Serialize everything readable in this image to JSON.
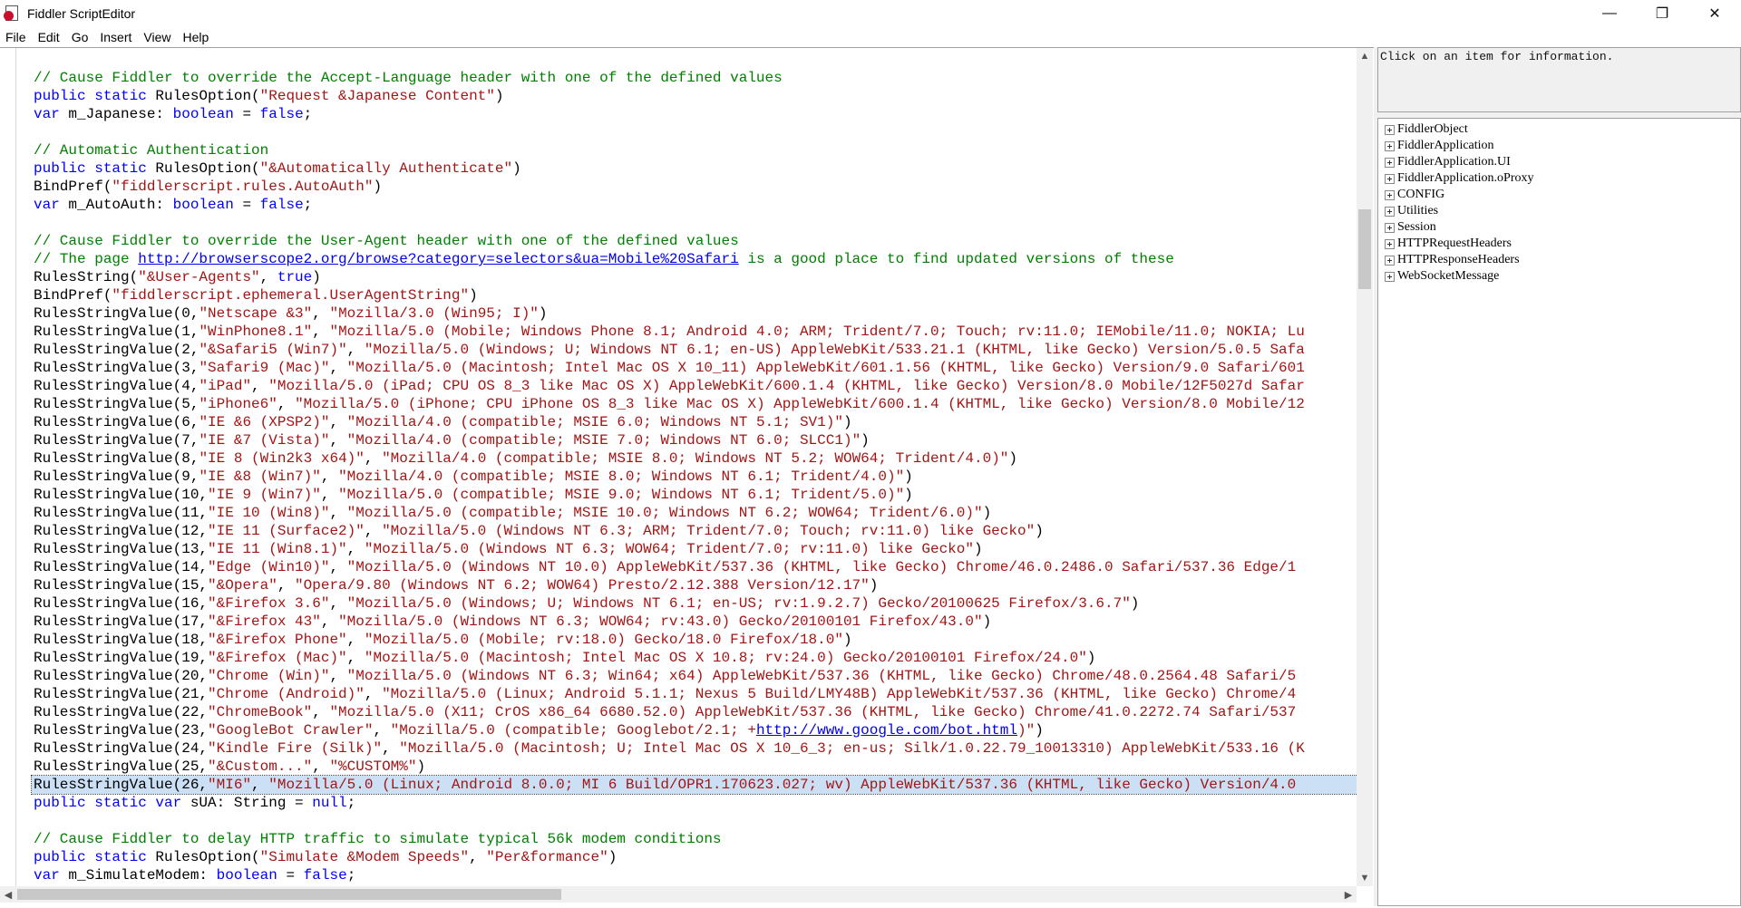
{
  "window": {
    "title": "Fiddler ScriptEditor",
    "minimize": "—",
    "restore": "❐",
    "close": "✕"
  },
  "menu": [
    "File",
    "Edit",
    "Go",
    "Insert",
    "View",
    "Help"
  ],
  "code": [
    [
      [
        "c",
        "// Cause Fiddler to override the Accept-Language header with one of the defined values"
      ]
    ],
    [
      [
        "k",
        "public static "
      ],
      [
        "d",
        "RulesOption("
      ],
      [
        "s",
        "\"Request &Japanese Content\""
      ],
      [
        "d",
        ")"
      ]
    ],
    [
      [
        "k",
        "var "
      ],
      [
        "d",
        "m_Japanese: "
      ],
      [
        "k",
        "boolean"
      ],
      [
        "d",
        " = "
      ],
      [
        "k",
        "false"
      ],
      [
        "d",
        ";"
      ]
    ],
    [],
    [
      [
        "c",
        "// Automatic Authentication"
      ]
    ],
    [
      [
        "k",
        "public static "
      ],
      [
        "d",
        "RulesOption("
      ],
      [
        "s",
        "\"&Automatically Authenticate\""
      ],
      [
        "d",
        ")"
      ]
    ],
    [
      [
        "d",
        "BindPref("
      ],
      [
        "s",
        "\"fiddlerscript.rules.AutoAuth\""
      ],
      [
        "d",
        ")"
      ]
    ],
    [
      [
        "k",
        "var "
      ],
      [
        "d",
        "m_AutoAuth: "
      ],
      [
        "k",
        "boolean"
      ],
      [
        "d",
        " = "
      ],
      [
        "k",
        "false"
      ],
      [
        "d",
        ";"
      ]
    ],
    [],
    [
      [
        "c",
        "// Cause Fiddler to override the User-Agent header with one of the defined values"
      ]
    ],
    [
      [
        "c",
        "// The page "
      ],
      [
        "l",
        "http://browserscope2.org/browse?category=selectors&ua=Mobile%20Safari"
      ],
      [
        "c",
        " is a good place to find updated versions of these"
      ]
    ],
    [
      [
        "d",
        "RulesString("
      ],
      [
        "s",
        "\"&User-Agents\""
      ],
      [
        "d",
        ", "
      ],
      [
        "k",
        "true"
      ],
      [
        "d",
        ")"
      ]
    ],
    [
      [
        "d",
        "BindPref("
      ],
      [
        "s",
        "\"fiddlerscript.ephemeral.UserAgentString\""
      ],
      [
        "d",
        ")"
      ]
    ],
    [
      [
        "d",
        "RulesStringValue(0,"
      ],
      [
        "s",
        "\"Netscape &3\""
      ],
      [
        "d",
        ", "
      ],
      [
        "s",
        "\"Mozilla/3.0 (Win95; I)\""
      ],
      [
        "d",
        ")"
      ]
    ],
    [
      [
        "d",
        "RulesStringValue(1,"
      ],
      [
        "s",
        "\"WinPhone8.1\""
      ],
      [
        "d",
        ", "
      ],
      [
        "s",
        "\"Mozilla/5.0 (Mobile; Windows Phone 8.1; Android 4.0; ARM; Trident/7.0; Touch; rv:11.0; IEMobile/11.0; NOKIA; Lu"
      ]
    ],
    [
      [
        "d",
        "RulesStringValue(2,"
      ],
      [
        "s",
        "\"&Safari5 (Win7)\""
      ],
      [
        "d",
        ", "
      ],
      [
        "s",
        "\"Mozilla/5.0 (Windows; U; Windows NT 6.1; en-US) AppleWebKit/533.21.1 (KHTML, like Gecko) Version/5.0.5 Safa"
      ]
    ],
    [
      [
        "d",
        "RulesStringValue(3,"
      ],
      [
        "s",
        "\"Safari9 (Mac)\""
      ],
      [
        "d",
        ", "
      ],
      [
        "s",
        "\"Mozilla/5.0 (Macintosh; Intel Mac OS X 10_11) AppleWebKit/601.1.56 (KHTML, like Gecko) Version/9.0 Safari/601"
      ]
    ],
    [
      [
        "d",
        "RulesStringValue(4,"
      ],
      [
        "s",
        "\"iPad\""
      ],
      [
        "d",
        ", "
      ],
      [
        "s",
        "\"Mozilla/5.0 (iPad; CPU OS 8_3 like Mac OS X) AppleWebKit/600.1.4 (KHTML, like Gecko) Version/8.0 Mobile/12F5027d Safar"
      ]
    ],
    [
      [
        "d",
        "RulesStringValue(5,"
      ],
      [
        "s",
        "\"iPhone6\""
      ],
      [
        "d",
        ", "
      ],
      [
        "s",
        "\"Mozilla/5.0 (iPhone; CPU iPhone OS 8_3 like Mac OS X) AppleWebKit/600.1.4 (KHTML, like Gecko) Version/8.0 Mobile/12"
      ]
    ],
    [
      [
        "d",
        "RulesStringValue(6,"
      ],
      [
        "s",
        "\"IE &6 (XPSP2)\""
      ],
      [
        "d",
        ", "
      ],
      [
        "s",
        "\"Mozilla/4.0 (compatible; MSIE 6.0; Windows NT 5.1; SV1)\""
      ],
      [
        "d",
        ")"
      ]
    ],
    [
      [
        "d",
        "RulesStringValue(7,"
      ],
      [
        "s",
        "\"IE &7 (Vista)\""
      ],
      [
        "d",
        ", "
      ],
      [
        "s",
        "\"Mozilla/4.0 (compatible; MSIE 7.0; Windows NT 6.0; SLCC1)\""
      ],
      [
        "d",
        ")"
      ]
    ],
    [
      [
        "d",
        "RulesStringValue(8,"
      ],
      [
        "s",
        "\"IE 8 (Win2k3 x64)\""
      ],
      [
        "d",
        ", "
      ],
      [
        "s",
        "\"Mozilla/4.0 (compatible; MSIE 8.0; Windows NT 5.2; WOW64; Trident/4.0)\""
      ],
      [
        "d",
        ")"
      ]
    ],
    [
      [
        "d",
        "RulesStringValue(9,"
      ],
      [
        "s",
        "\"IE &8 (Win7)\""
      ],
      [
        "d",
        ", "
      ],
      [
        "s",
        "\"Mozilla/4.0 (compatible; MSIE 8.0; Windows NT 6.1; Trident/4.0)\""
      ],
      [
        "d",
        ")"
      ]
    ],
    [
      [
        "d",
        "RulesStringValue(10,"
      ],
      [
        "s",
        "\"IE 9 (Win7)\""
      ],
      [
        "d",
        ", "
      ],
      [
        "s",
        "\"Mozilla/5.0 (compatible; MSIE 9.0; Windows NT 6.1; Trident/5.0)\""
      ],
      [
        "d",
        ")"
      ]
    ],
    [
      [
        "d",
        "RulesStringValue(11,"
      ],
      [
        "s",
        "\"IE 10 (Win8)\""
      ],
      [
        "d",
        ", "
      ],
      [
        "s",
        "\"Mozilla/5.0 (compatible; MSIE 10.0; Windows NT 6.2; WOW64; Trident/6.0)\""
      ],
      [
        "d",
        ")"
      ]
    ],
    [
      [
        "d",
        "RulesStringValue(12,"
      ],
      [
        "s",
        "\"IE 11 (Surface2)\""
      ],
      [
        "d",
        ", "
      ],
      [
        "s",
        "\"Mozilla/5.0 (Windows NT 6.3; ARM; Trident/7.0; Touch; rv:11.0) like Gecko\""
      ],
      [
        "d",
        ")"
      ]
    ],
    [
      [
        "d",
        "RulesStringValue(13,"
      ],
      [
        "s",
        "\"IE 11 (Win8.1)\""
      ],
      [
        "d",
        ", "
      ],
      [
        "s",
        "\"Mozilla/5.0 (Windows NT 6.3; WOW64; Trident/7.0; rv:11.0) like Gecko\""
      ],
      [
        "d",
        ")"
      ]
    ],
    [
      [
        "d",
        "RulesStringValue(14,"
      ],
      [
        "s",
        "\"Edge (Win10)\""
      ],
      [
        "d",
        ", "
      ],
      [
        "s",
        "\"Mozilla/5.0 (Windows NT 10.0) AppleWebKit/537.36 (KHTML, like Gecko) Chrome/46.0.2486.0 Safari/537.36 Edge/1"
      ]
    ],
    [
      [
        "d",
        "RulesStringValue(15,"
      ],
      [
        "s",
        "\"&Opera\""
      ],
      [
        "d",
        ", "
      ],
      [
        "s",
        "\"Opera/9.80 (Windows NT 6.2; WOW64) Presto/2.12.388 Version/12.17\""
      ],
      [
        "d",
        ")"
      ]
    ],
    [
      [
        "d",
        "RulesStringValue(16,"
      ],
      [
        "s",
        "\"&Firefox 3.6\""
      ],
      [
        "d",
        ", "
      ],
      [
        "s",
        "\"Mozilla/5.0 (Windows; U; Windows NT 6.1; en-US; rv:1.9.2.7) Gecko/20100625 Firefox/3.6.7\""
      ],
      [
        "d",
        ")"
      ]
    ],
    [
      [
        "d",
        "RulesStringValue(17,"
      ],
      [
        "s",
        "\"&Firefox 43\""
      ],
      [
        "d",
        ", "
      ],
      [
        "s",
        "\"Mozilla/5.0 (Windows NT 6.3; WOW64; rv:43.0) Gecko/20100101 Firefox/43.0\""
      ],
      [
        "d",
        ")"
      ]
    ],
    [
      [
        "d",
        "RulesStringValue(18,"
      ],
      [
        "s",
        "\"&Firefox Phone\""
      ],
      [
        "d",
        ", "
      ],
      [
        "s",
        "\"Mozilla/5.0 (Mobile; rv:18.0) Gecko/18.0 Firefox/18.0\""
      ],
      [
        "d",
        ")"
      ]
    ],
    [
      [
        "d",
        "RulesStringValue(19,"
      ],
      [
        "s",
        "\"&Firefox (Mac)\""
      ],
      [
        "d",
        ", "
      ],
      [
        "s",
        "\"Mozilla/5.0 (Macintosh; Intel Mac OS X 10.8; rv:24.0) Gecko/20100101 Firefox/24.0\""
      ],
      [
        "d",
        ")"
      ]
    ],
    [
      [
        "d",
        "RulesStringValue(20,"
      ],
      [
        "s",
        "\"Chrome (Win)\""
      ],
      [
        "d",
        ", "
      ],
      [
        "s",
        "\"Mozilla/5.0 (Windows NT 6.3; Win64; x64) AppleWebKit/537.36 (KHTML, like Gecko) Chrome/48.0.2564.48 Safari/5"
      ]
    ],
    [
      [
        "d",
        "RulesStringValue(21,"
      ],
      [
        "s",
        "\"Chrome (Android)\""
      ],
      [
        "d",
        ", "
      ],
      [
        "s",
        "\"Mozilla/5.0 (Linux; Android 5.1.1; Nexus 5 Build/LMY48B) AppleWebKit/537.36 (KHTML, like Gecko) Chrome/4"
      ]
    ],
    [
      [
        "d",
        "RulesStringValue(22,"
      ],
      [
        "s",
        "\"ChromeBook\""
      ],
      [
        "d",
        ", "
      ],
      [
        "s",
        "\"Mozilla/5.0 (X11; CrOS x86_64 6680.52.0) AppleWebKit/537.36 (KHTML, like Gecko) Chrome/41.0.2272.74 Safari/537"
      ]
    ],
    [
      [
        "d",
        "RulesStringValue(23,"
      ],
      [
        "s",
        "\"GoogleBot Crawler\""
      ],
      [
        "d",
        ", "
      ],
      [
        "s",
        "\"Mozilla/5.0 (compatible; Googlebot/2.1; +"
      ],
      [
        "l",
        "http://www.google.com/bot.html"
      ],
      [
        "s",
        ")\""
      ],
      [
        "d",
        ")"
      ]
    ],
    [
      [
        "d",
        "RulesStringValue(24,"
      ],
      [
        "s",
        "\"Kindle Fire (Silk)\""
      ],
      [
        "d",
        ", "
      ],
      [
        "s",
        "\"Mozilla/5.0 (Macintosh; U; Intel Mac OS X 10_6_3; en-us; Silk/1.0.22.79_10013310) AppleWebKit/533.16 (K"
      ]
    ],
    [
      [
        "d",
        "RulesStringValue(25,"
      ],
      [
        "s",
        "\"&Custom...\""
      ],
      [
        "d",
        ", "
      ],
      [
        "s",
        "\"%CUSTOM%\""
      ],
      [
        "d",
        ")"
      ]
    ],
    [
      [
        "d",
        "RulesStringValue(26,"
      ],
      [
        "s",
        "\"MI6\""
      ],
      [
        "d",
        ", "
      ],
      [
        "s",
        "\"Mozilla/5.0 (Linux; Android 8.0.0; MI 6 Build/OPR1.170623.027; wv) AppleWebKit/537.36 (KHTML, like Gecko) Version/4.0"
      ]
    ],
    [
      [
        "k",
        "public static var "
      ],
      [
        "d",
        "sUA: String = "
      ],
      [
        "k",
        "null"
      ],
      [
        "d",
        ";"
      ]
    ],
    [],
    [
      [
        "c",
        "// Cause Fiddler to delay HTTP traffic to simulate typical 56k modem conditions"
      ]
    ],
    [
      [
        "k",
        "public static "
      ],
      [
        "d",
        "RulesOption("
      ],
      [
        "s",
        "\"Simulate &Modem Speeds\""
      ],
      [
        "d",
        ", "
      ],
      [
        "s",
        "\"Per&formance\""
      ],
      [
        "d",
        ")"
      ]
    ],
    [
      [
        "k",
        "var "
      ],
      [
        "d",
        "m_SimulateModem: "
      ],
      [
        "k",
        "boolean"
      ],
      [
        "d",
        " = "
      ],
      [
        "k",
        "false"
      ],
      [
        "d",
        ";"
      ]
    ]
  ],
  "highlighted_line_index": 39,
  "colors": {
    "comment": "#008000",
    "keyword": "#0000ff",
    "string": "#a31515",
    "link": "#0000ee",
    "selection": "#cce0f5"
  },
  "side": {
    "info": "Click on an item for information.",
    "tree": [
      "FiddlerObject",
      "FiddlerApplication",
      "FiddlerApplication.UI",
      "FiddlerApplication.oProxy",
      "CONFIG",
      "Utilities",
      "Session",
      "HTTPRequestHeaders",
      "HTTPResponseHeaders",
      "WebSocketMessage"
    ]
  },
  "icons": {
    "app": "fiddler-app-icon",
    "scroll_up": "▲",
    "scroll_down": "▼",
    "scroll_left": "◀",
    "scroll_right": "▶"
  }
}
